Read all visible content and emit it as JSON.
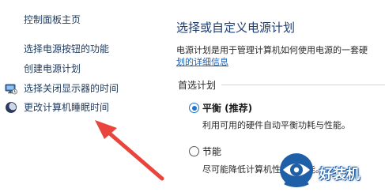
{
  "left_nav": {
    "items": [
      {
        "label": "控制面板主页"
      },
      {
        "label": "选择电源按钮的功能"
      },
      {
        "label": "创建电源计划"
      },
      {
        "label": "选择关闭显示器的时间",
        "icon": "monitor-icon"
      },
      {
        "label": "更改计算机睡眠时间",
        "icon": "moon-icon"
      }
    ]
  },
  "main": {
    "title": "选择或自定义电源计划",
    "description": "电源计划是用于管理计算机如何使用电源的一套硬",
    "link": "划的详细信息",
    "section_label": "首选计划",
    "plans": [
      {
        "name": "平衡 (推荐)",
        "desc": "利用可用的硬件自动平衡功耗与性能。",
        "selected": true
      },
      {
        "name": "节能",
        "desc": "尽可能降低计算机性能以节能。",
        "selected": false
      }
    ]
  },
  "annotation": {
    "color": "#e8453c"
  },
  "watermark": {
    "text": "好装机",
    "color": "#1f5fa8"
  }
}
